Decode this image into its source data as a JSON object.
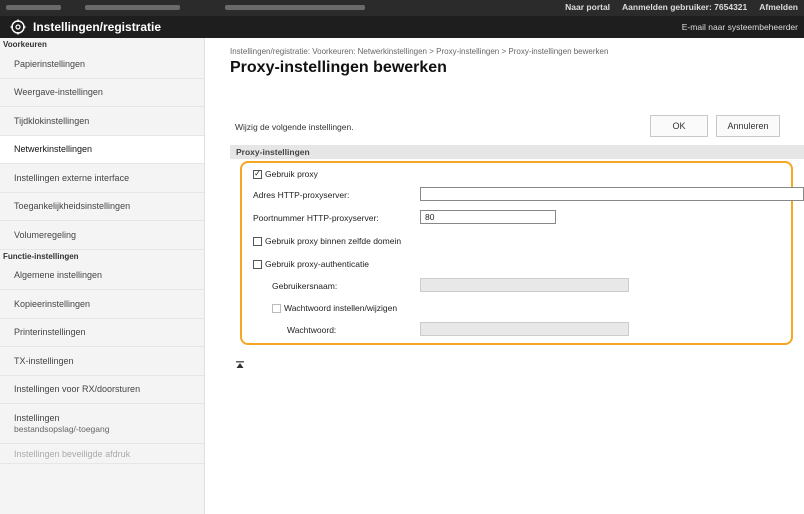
{
  "topbar": {
    "portal_label": "Naar portal",
    "user_prefix": "Aanmelden gebruiker:",
    "user_id": "7654321",
    "logout_label": "Afmelden"
  },
  "titlebar": {
    "title": "Instellingen/registratie",
    "mail_link": "E-mail naar systeembeheerder",
    "icon": "settings-gear-icon"
  },
  "sidebar": {
    "section1": "Voorkeuren",
    "items1": [
      {
        "label": "Papierinstellingen"
      },
      {
        "label": "Weergave-instellingen"
      },
      {
        "label": "Tijdklokinstellingen"
      },
      {
        "label": "Netwerkinstellingen"
      },
      {
        "label": "Instellingen externe interface"
      },
      {
        "label": "Toegankelijkheidsinstellingen"
      },
      {
        "label": "Volumeregeling"
      }
    ],
    "section2": "Functie-instellingen",
    "items2": [
      {
        "label": "Algemene instellingen"
      },
      {
        "label": "Kopieerinstellingen"
      },
      {
        "label": "Printerinstellingen"
      },
      {
        "label": "TX-instellingen"
      },
      {
        "label": "Instellingen voor RX/doorsturen"
      }
    ],
    "multi_item": {
      "line1": "Instellingen",
      "line2": "bestandsopslag/-toegang"
    },
    "faded_item": "Instellingen beveiligde afdruk"
  },
  "main": {
    "breadcrumb": "Instellingen/registratie: Voorkeuren: Netwerkinstellingen > Proxy-instellingen > Proxy-instellingen bewerken",
    "title": "Proxy-instellingen bewerken",
    "instruction": "Wijzig de volgende instellingen.",
    "ok_label": "OK",
    "cancel_label": "Annuleren",
    "section_header": "Proxy-instellingen",
    "use_proxy_label": "Gebruik proxy",
    "use_proxy_checked": true,
    "http_address_label": "Adres HTTP-proxyserver:",
    "http_address_value": "",
    "http_port_label": "Poortnummer HTTP-proxyserver:",
    "http_port_value": "80",
    "same_domain_label": "Gebruik proxy binnen zelfde domein",
    "same_domain_checked": false,
    "auth_label": "Gebruik proxy-authenticatie",
    "auth_checked": false,
    "username_label": "Gebruikersnaam:",
    "username_value": "",
    "set_password_label": "Wachtwoord instellen/wijzigen",
    "set_password_checked": false,
    "password_label": "Wachtwoord:",
    "password_value": ""
  },
  "colors": {
    "highlight": "#f5a623",
    "titlebar_bg": "#1e1e1e",
    "topbar_bg": "#2b2b2b"
  }
}
